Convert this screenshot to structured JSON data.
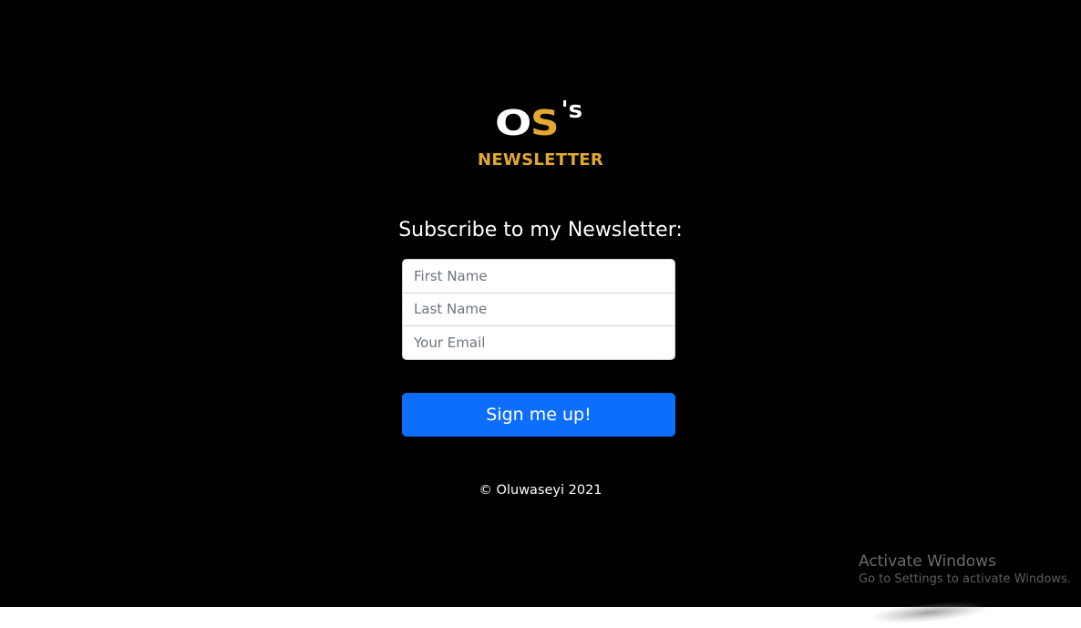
{
  "brand": {
    "logo_o": "O",
    "logo_s": "S",
    "logo_apos": "'s",
    "subtitle": "NEWSLETTER"
  },
  "form": {
    "heading": "Subscribe to my Newsletter:",
    "first_name": {
      "placeholder": "First Name",
      "value": ""
    },
    "last_name": {
      "placeholder": "Last Name",
      "value": ""
    },
    "email": {
      "placeholder": "Your Email",
      "value": ""
    },
    "submit_label": "Sign me up!"
  },
  "footer": {
    "copyright": "© Oluwaseyi 2021"
  },
  "os_watermark": {
    "title": "Activate Windows",
    "subtitle": "Go to Settings to activate Windows."
  },
  "colors": {
    "background": "#000000",
    "accent_gold": "#e3a830",
    "button_blue": "#0d6efd",
    "text_white": "#ffffff"
  }
}
